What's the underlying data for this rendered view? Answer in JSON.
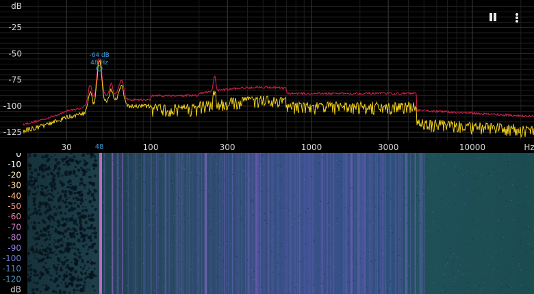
{
  "spectrum": {
    "db_labels": [
      "dB",
      "-25",
      "-50",
      "-75",
      "-100",
      "-125"
    ],
    "db_values": [
      0,
      -25,
      -50,
      -75,
      -100,
      -125
    ],
    "freq_labels": [
      "30",
      "100",
      "300",
      "1000",
      "3000",
      "10000",
      "Hz"
    ],
    "freq_values": [
      30,
      100,
      300,
      1000,
      3000,
      10000,
      null
    ],
    "peak": {
      "db_text": "-64 dB",
      "hz_text": "48 Hz",
      "marker_text": "48",
      "freq": 48,
      "db": -64
    },
    "colors": {
      "grid": "#333333",
      "label": "#d8d8d8",
      "accent": "#3aa0e0",
      "current": "#f2d21b",
      "max_hold": "#d0204a"
    }
  },
  "spectrogram": {
    "db_labels": [
      "0",
      "-10",
      "-20",
      "-30",
      "-40",
      "-50",
      "-60",
      "-70",
      "-80",
      "-90",
      "-100",
      "-110",
      "-120",
      "dB"
    ],
    "label_colors": [
      "#ffffff",
      "#ffffff",
      "#fff0c8",
      "#ffd9a0",
      "#ffbc8a",
      "#ff9a86",
      "#f27fa5",
      "#d877c4",
      "#b67ad6",
      "#8f80dc",
      "#6f7fd4",
      "#5487c8",
      "#4e8fb8",
      "#cccccc"
    ]
  },
  "controls": {
    "pause_icon": "pause-icon",
    "menu_icon": "more-vert-icon"
  }
}
